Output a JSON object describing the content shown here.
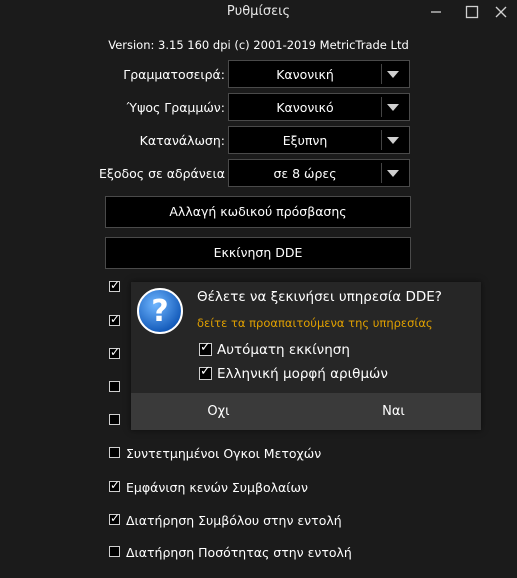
{
  "window": {
    "title": "Ρυθμίσεις"
  },
  "version": "Version: 3.15  160 dpi (c) 2001-2019 MetricTrade Ltd",
  "settings": [
    {
      "label": "Γραμματοσειρά:",
      "value": "Κανονική"
    },
    {
      "label": "Ύψος Γραμμών:",
      "value": "Κανονικό"
    },
    {
      "label": "Κατανάλωση:",
      "value": "Εξυπνη"
    },
    {
      "label": "Εξοδος σε αδράνεια",
      "value": "σε 8 ώρες"
    }
  ],
  "buttons": {
    "change_password": "Αλλαγή κωδικού πρόσβασης",
    "start_dde": "Εκκίνηση DDE"
  },
  "checkboxes": [
    {
      "label": "",
      "checked": true
    },
    {
      "label": "",
      "checked": true
    },
    {
      "label": "",
      "checked": true
    },
    {
      "label": "",
      "checked": false
    },
    {
      "label": "",
      "checked": false
    },
    {
      "label": "Συντετμημένοι Ογκοι Μετοχών",
      "checked": false
    },
    {
      "label": "Εμφάνιση κενών Συμβολαίων",
      "checked": true
    },
    {
      "label": "Διατήρηση Συμβόλου στην εντολή",
      "checked": true
    },
    {
      "label": "Διατήρηση Ποσότητας στην εντολή",
      "checked": false
    }
  ],
  "dialog": {
    "question": "Θέλετε να ξεκινήσει υπηρεσία DDE?",
    "subtitle": "δείτε τα προαπαιτούμενα της υπηρεσίας",
    "options": [
      {
        "label": "Αυτόματη εκκίνηση",
        "checked": true
      },
      {
        "label": "Ελληνική μορφή αριθμών",
        "checked": true
      }
    ],
    "no": "Οχι",
    "yes": "Ναι"
  },
  "colors": {
    "background": "#1b1b1b",
    "control": "#000000",
    "accent": "#e0a000",
    "icon": "#1e6fd0"
  }
}
